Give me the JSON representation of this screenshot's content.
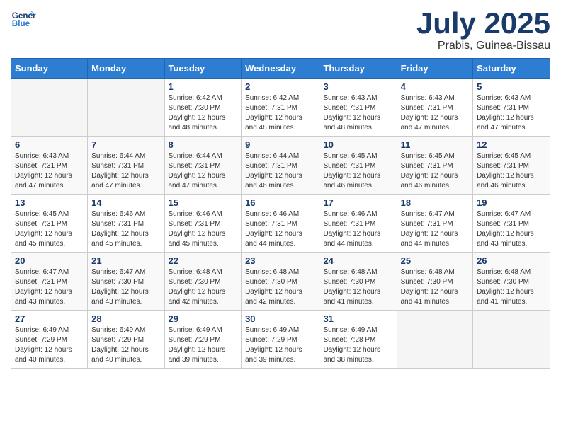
{
  "header": {
    "logo_line1": "General",
    "logo_line2": "Blue",
    "title": "July 2025",
    "location": "Prabis, Guinea-Bissau"
  },
  "weekdays": [
    "Sunday",
    "Monday",
    "Tuesday",
    "Wednesday",
    "Thursday",
    "Friday",
    "Saturday"
  ],
  "weeks": [
    [
      {
        "day": "",
        "sunrise": "",
        "sunset": "",
        "daylight": ""
      },
      {
        "day": "",
        "sunrise": "",
        "sunset": "",
        "daylight": ""
      },
      {
        "day": "1",
        "sunrise": "Sunrise: 6:42 AM",
        "sunset": "Sunset: 7:30 PM",
        "daylight": "Daylight: 12 hours and 48 minutes."
      },
      {
        "day": "2",
        "sunrise": "Sunrise: 6:42 AM",
        "sunset": "Sunset: 7:31 PM",
        "daylight": "Daylight: 12 hours and 48 minutes."
      },
      {
        "day": "3",
        "sunrise": "Sunrise: 6:43 AM",
        "sunset": "Sunset: 7:31 PM",
        "daylight": "Daylight: 12 hours and 48 minutes."
      },
      {
        "day": "4",
        "sunrise": "Sunrise: 6:43 AM",
        "sunset": "Sunset: 7:31 PM",
        "daylight": "Daylight: 12 hours and 47 minutes."
      },
      {
        "day": "5",
        "sunrise": "Sunrise: 6:43 AM",
        "sunset": "Sunset: 7:31 PM",
        "daylight": "Daylight: 12 hours and 47 minutes."
      }
    ],
    [
      {
        "day": "6",
        "sunrise": "Sunrise: 6:43 AM",
        "sunset": "Sunset: 7:31 PM",
        "daylight": "Daylight: 12 hours and 47 minutes."
      },
      {
        "day": "7",
        "sunrise": "Sunrise: 6:44 AM",
        "sunset": "Sunset: 7:31 PM",
        "daylight": "Daylight: 12 hours and 47 minutes."
      },
      {
        "day": "8",
        "sunrise": "Sunrise: 6:44 AM",
        "sunset": "Sunset: 7:31 PM",
        "daylight": "Daylight: 12 hours and 47 minutes."
      },
      {
        "day": "9",
        "sunrise": "Sunrise: 6:44 AM",
        "sunset": "Sunset: 7:31 PM",
        "daylight": "Daylight: 12 hours and 46 minutes."
      },
      {
        "day": "10",
        "sunrise": "Sunrise: 6:45 AM",
        "sunset": "Sunset: 7:31 PM",
        "daylight": "Daylight: 12 hours and 46 minutes."
      },
      {
        "day": "11",
        "sunrise": "Sunrise: 6:45 AM",
        "sunset": "Sunset: 7:31 PM",
        "daylight": "Daylight: 12 hours and 46 minutes."
      },
      {
        "day": "12",
        "sunrise": "Sunrise: 6:45 AM",
        "sunset": "Sunset: 7:31 PM",
        "daylight": "Daylight: 12 hours and 46 minutes."
      }
    ],
    [
      {
        "day": "13",
        "sunrise": "Sunrise: 6:45 AM",
        "sunset": "Sunset: 7:31 PM",
        "daylight": "Daylight: 12 hours and 45 minutes."
      },
      {
        "day": "14",
        "sunrise": "Sunrise: 6:46 AM",
        "sunset": "Sunset: 7:31 PM",
        "daylight": "Daylight: 12 hours and 45 minutes."
      },
      {
        "day": "15",
        "sunrise": "Sunrise: 6:46 AM",
        "sunset": "Sunset: 7:31 PM",
        "daylight": "Daylight: 12 hours and 45 minutes."
      },
      {
        "day": "16",
        "sunrise": "Sunrise: 6:46 AM",
        "sunset": "Sunset: 7:31 PM",
        "daylight": "Daylight: 12 hours and 44 minutes."
      },
      {
        "day": "17",
        "sunrise": "Sunrise: 6:46 AM",
        "sunset": "Sunset: 7:31 PM",
        "daylight": "Daylight: 12 hours and 44 minutes."
      },
      {
        "day": "18",
        "sunrise": "Sunrise: 6:47 AM",
        "sunset": "Sunset: 7:31 PM",
        "daylight": "Daylight: 12 hours and 44 minutes."
      },
      {
        "day": "19",
        "sunrise": "Sunrise: 6:47 AM",
        "sunset": "Sunset: 7:31 PM",
        "daylight": "Daylight: 12 hours and 43 minutes."
      }
    ],
    [
      {
        "day": "20",
        "sunrise": "Sunrise: 6:47 AM",
        "sunset": "Sunset: 7:31 PM",
        "daylight": "Daylight: 12 hours and 43 minutes."
      },
      {
        "day": "21",
        "sunrise": "Sunrise: 6:47 AM",
        "sunset": "Sunset: 7:30 PM",
        "daylight": "Daylight: 12 hours and 43 minutes."
      },
      {
        "day": "22",
        "sunrise": "Sunrise: 6:48 AM",
        "sunset": "Sunset: 7:30 PM",
        "daylight": "Daylight: 12 hours and 42 minutes."
      },
      {
        "day": "23",
        "sunrise": "Sunrise: 6:48 AM",
        "sunset": "Sunset: 7:30 PM",
        "daylight": "Daylight: 12 hours and 42 minutes."
      },
      {
        "day": "24",
        "sunrise": "Sunrise: 6:48 AM",
        "sunset": "Sunset: 7:30 PM",
        "daylight": "Daylight: 12 hours and 41 minutes."
      },
      {
        "day": "25",
        "sunrise": "Sunrise: 6:48 AM",
        "sunset": "Sunset: 7:30 PM",
        "daylight": "Daylight: 12 hours and 41 minutes."
      },
      {
        "day": "26",
        "sunrise": "Sunrise: 6:48 AM",
        "sunset": "Sunset: 7:30 PM",
        "daylight": "Daylight: 12 hours and 41 minutes."
      }
    ],
    [
      {
        "day": "27",
        "sunrise": "Sunrise: 6:49 AM",
        "sunset": "Sunset: 7:29 PM",
        "daylight": "Daylight: 12 hours and 40 minutes."
      },
      {
        "day": "28",
        "sunrise": "Sunrise: 6:49 AM",
        "sunset": "Sunset: 7:29 PM",
        "daylight": "Daylight: 12 hours and 40 minutes."
      },
      {
        "day": "29",
        "sunrise": "Sunrise: 6:49 AM",
        "sunset": "Sunset: 7:29 PM",
        "daylight": "Daylight: 12 hours and 39 minutes."
      },
      {
        "day": "30",
        "sunrise": "Sunrise: 6:49 AM",
        "sunset": "Sunset: 7:29 PM",
        "daylight": "Daylight: 12 hours and 39 minutes."
      },
      {
        "day": "31",
        "sunrise": "Sunrise: 6:49 AM",
        "sunset": "Sunset: 7:28 PM",
        "daylight": "Daylight: 12 hours and 38 minutes."
      },
      {
        "day": "",
        "sunrise": "",
        "sunset": "",
        "daylight": ""
      },
      {
        "day": "",
        "sunrise": "",
        "sunset": "",
        "daylight": ""
      }
    ]
  ]
}
